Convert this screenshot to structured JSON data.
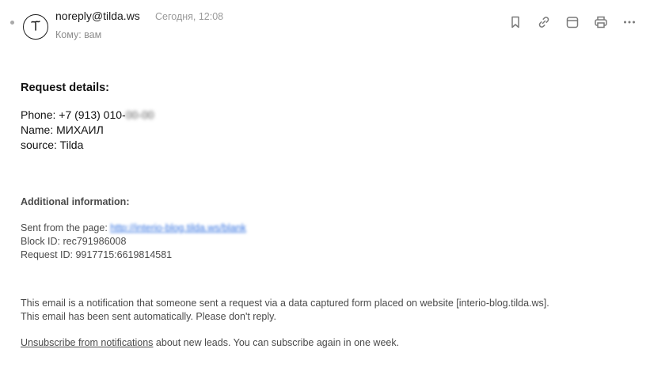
{
  "header": {
    "sender": "noreply@tilda.ws",
    "date": "Сегодня, 12:08",
    "to": "Кому: вам",
    "avatar_icon": "tilda-logo-icon"
  },
  "toolbar": {
    "icons": [
      "bookmark-icon",
      "link-icon",
      "calendar-icon",
      "print-icon",
      "more-icon"
    ]
  },
  "email": {
    "title": "Request details:",
    "phone_label": "Phone: +7 (913) 010-",
    "phone_hidden": "00-00",
    "name": "Name: МИХАИЛ",
    "source": "source: Tilda",
    "additional_title": "Additional information:",
    "sent_from_label": "Sent from the page: ",
    "sent_from_url": "http://interio-blog.tilda.ws/blank",
    "block_id": "Block ID: rec791986008",
    "request_id": "Request ID: 9917715:6619814581",
    "notice_1": "This email is a notification that someone sent a request via a data captured form placed on website [interio-blog.tilda.ws].",
    "notice_2": "This email has been sent automatically. Please don't reply.",
    "unsubscribe_link": "Unsubscribe from notifications",
    "unsubscribe_rest": " about new leads. You can subscribe again in one week."
  }
}
